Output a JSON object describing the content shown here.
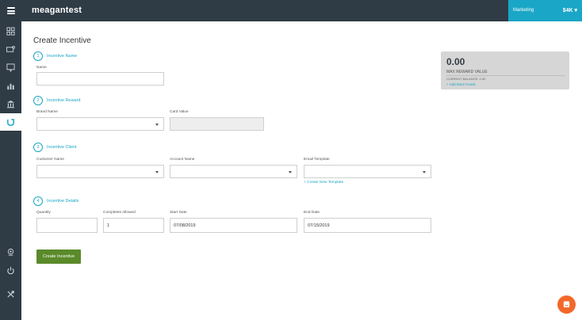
{
  "header": {
    "brand": "meagantest",
    "department": "Marketing",
    "balance_badge": "$4K ▾"
  },
  "sidebar": {
    "items": [
      {
        "icon": "dashboard-icon"
      },
      {
        "icon": "cards-icon"
      },
      {
        "icon": "message-icon"
      },
      {
        "icon": "bar-chart-icon"
      },
      {
        "icon": "bank-icon"
      },
      {
        "icon": "incentive-icon",
        "active": true
      }
    ],
    "bottom_items": [
      {
        "icon": "support-icon"
      },
      {
        "icon": "power-icon"
      },
      {
        "icon": "tools-icon"
      }
    ]
  },
  "page": {
    "title": "Create Incentive"
  },
  "steps": {
    "s1": {
      "num": "1",
      "title": "Incentive Name"
    },
    "s2": {
      "num": "2",
      "title": "Incentive Reward"
    },
    "s3": {
      "num": "3",
      "title": "Incentive Client"
    },
    "s4": {
      "num": "4",
      "title": "Incentive Details"
    }
  },
  "fields": {
    "name": {
      "label": "Name",
      "value": ""
    },
    "brand_name": {
      "label": "Brand Name",
      "value": ""
    },
    "card_value": {
      "label": "Card Value",
      "value": ""
    },
    "customer_name": {
      "label": "Customer Name",
      "value": ""
    },
    "account_name": {
      "label": "Account Name",
      "value": ""
    },
    "email_template": {
      "label": "Email Template",
      "value": ""
    },
    "quantity": {
      "label": "Quantity",
      "value": ""
    },
    "completes_allowed": {
      "label": "Completes Allowed",
      "value": "1"
    },
    "start_date": {
      "label": "Start Date",
      "value": "07/08/2019"
    },
    "end_date": {
      "label": "End Date",
      "value": "07/15/2019"
    }
  },
  "links": {
    "create_template": "+ Create New Template"
  },
  "actions": {
    "create": "Create Incentive"
  },
  "reward": {
    "value": "0.00",
    "label": "MAX REWARD VALUE",
    "balance": "CURRENT BALANCE: 0.00",
    "add_funds": "+ Add More Funds"
  },
  "colors": {
    "accent": "#1aa6c7",
    "nav": "#2f3b45",
    "primary_button": "#5a8a2a",
    "chat": "#f2682a"
  }
}
